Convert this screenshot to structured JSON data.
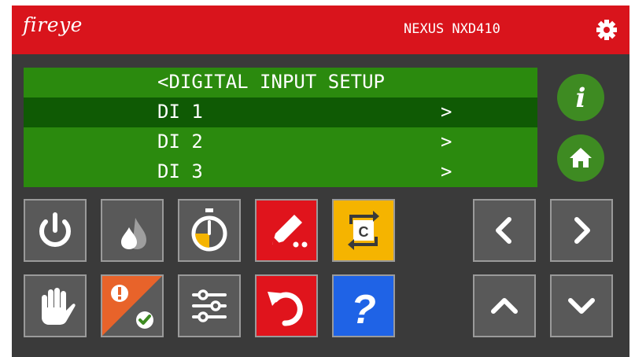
{
  "header": {
    "brand": "fireye",
    "model": "NEXUS NXD410",
    "settings_icon": "gear-icon"
  },
  "lcd": {
    "rows": [
      {
        "text": "<DIGITAL INPUT SETUP",
        "arrow": "",
        "selected": false
      },
      {
        "text": "DI 1",
        "arrow": ">",
        "selected": true
      },
      {
        "text": "DI 2",
        "arrow": ">",
        "selected": false
      },
      {
        "text": "DI 3",
        "arrow": ">",
        "selected": false
      }
    ]
  },
  "side_buttons": [
    {
      "icon": "info-icon",
      "label": "i"
    },
    {
      "icon": "home-icon"
    }
  ],
  "tiles": [
    {
      "icon": "power-icon",
      "color": "#595959"
    },
    {
      "icon": "flame-drop-icon",
      "color": "#595959"
    },
    {
      "icon": "timer-icon",
      "color": "#595959"
    },
    {
      "icon": "edit-pencil-icon",
      "color": "#e0141c"
    },
    {
      "icon": "cycle-c-icon",
      "color": "#f5b400",
      "label": "C"
    },
    {
      "icon": "hand-stop-icon",
      "color": "#595959"
    },
    {
      "icon": "alarm-ack-icon",
      "color": "#e8632a"
    },
    {
      "icon": "sliders-icon",
      "color": "#595959"
    },
    {
      "icon": "undo-icon",
      "color": "#e0141c"
    },
    {
      "icon": "help-icon",
      "color": "#1f63e6",
      "label": "?"
    }
  ],
  "nav": [
    {
      "icon": "chevron-left-icon"
    },
    {
      "icon": "chevron-right-icon"
    },
    {
      "icon": "chevron-up-icon"
    },
    {
      "icon": "chevron-down-icon"
    }
  ]
}
